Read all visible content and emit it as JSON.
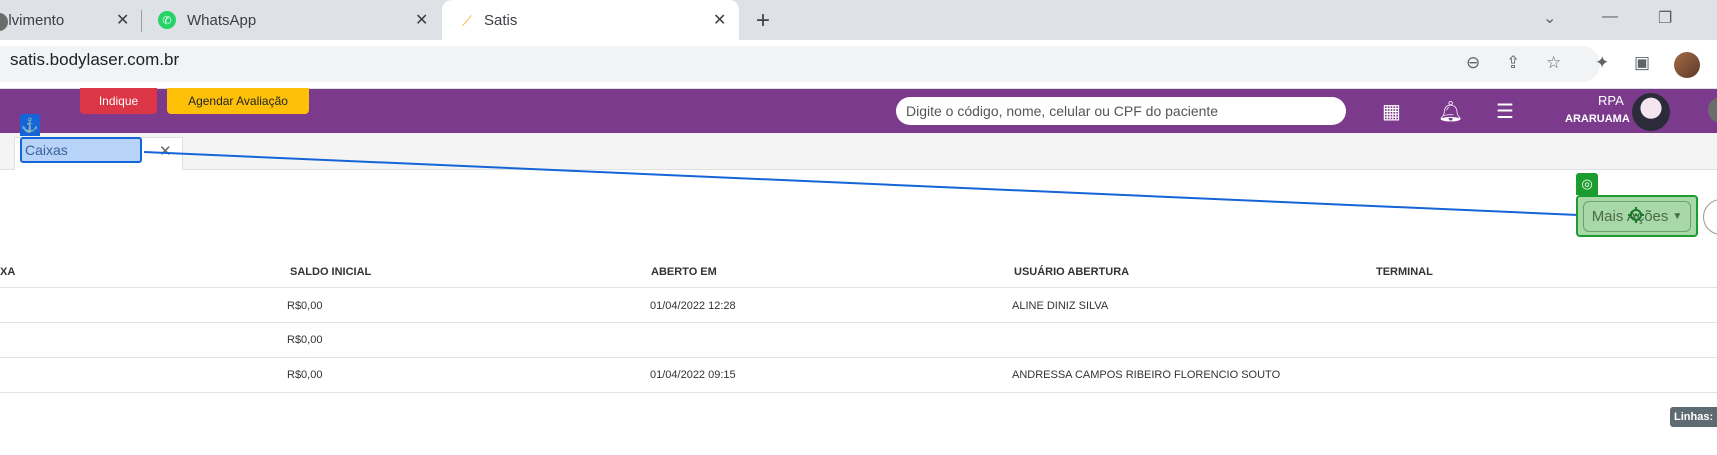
{
  "browser": {
    "tabs": [
      {
        "label": "olvimento"
      },
      {
        "label": "WhatsApp"
      },
      {
        "label": "Satis"
      }
    ],
    "url": "satis.bodylaser.com.br"
  },
  "header": {
    "indique_label": "Indique",
    "agendar_label": "Agendar Avaliação",
    "search_placeholder": "Digite o código, nome, celular ou CPF do paciente",
    "user_name": "RPA",
    "user_location": "ARARUAMA"
  },
  "page_tabs": [
    {
      "label": "Caixas"
    }
  ],
  "actions": {
    "mais_acoes_label": "Mais Ações"
  },
  "table": {
    "columns": [
      "XA",
      "SALDO INICIAL",
      "ABERTO EM",
      "USUÁRIO ABERTURA",
      "TERMINAL"
    ],
    "rows": [
      {
        "saldo": "R$0,00",
        "aberto": "01/04/2022 12:28",
        "usuario": "ALINE DINIZ SILVA",
        "terminal": ""
      },
      {
        "saldo": "R$0,00",
        "aberto": "",
        "usuario": "",
        "terminal": ""
      },
      {
        "saldo": "R$0,00",
        "aberto": "01/04/2022 09:15",
        "usuario": "ANDRESSA CAMPOS RIBEIRO FLORENCIO SOUTO",
        "terminal": ""
      }
    ]
  },
  "footer": {
    "linhas_label": "Linhas:"
  },
  "colors": {
    "header_purple": "#7b3a8c",
    "indique_red": "#dc3545",
    "agendar_yellow": "#ffc107",
    "anchor_blue": "#1565d8",
    "target_green": "#1a9c2e"
  }
}
